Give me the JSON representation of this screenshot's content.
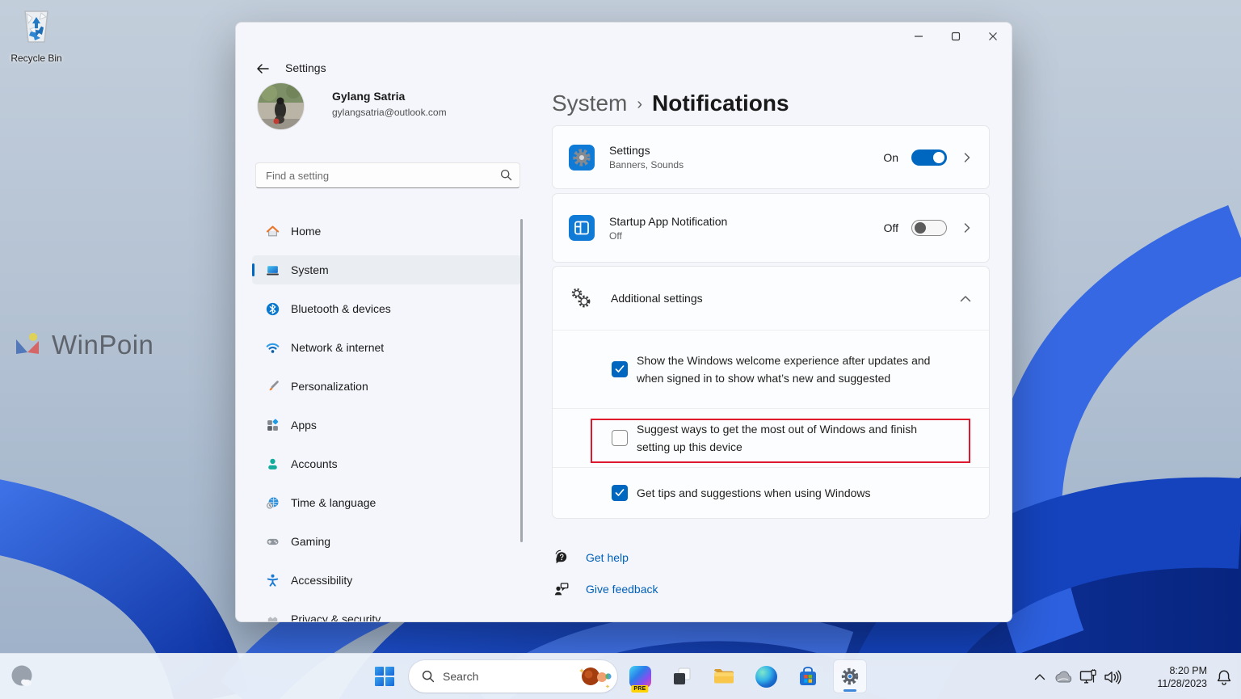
{
  "colors": {
    "accent": "#0067c0",
    "link": "#005fb8",
    "highlight_red": "#e0182d"
  },
  "desktop": {
    "recycle_bin_label": "Recycle Bin",
    "watermark": "WinPoin"
  },
  "window": {
    "titlebar": {
      "title": "Settings"
    },
    "profile": {
      "name": "Gylang Satria",
      "email": "gylangsatria@outlook.com"
    },
    "search": {
      "placeholder": "Find a setting"
    },
    "sidebar": {
      "items": [
        {
          "label": "Home"
        },
        {
          "label": "System"
        },
        {
          "label": "Bluetooth & devices"
        },
        {
          "label": "Network & internet"
        },
        {
          "label": "Personalization"
        },
        {
          "label": "Apps"
        },
        {
          "label": "Accounts"
        },
        {
          "label": "Time & language"
        },
        {
          "label": "Gaming"
        },
        {
          "label": "Accessibility"
        },
        {
          "label": "Privacy & security"
        }
      ]
    },
    "breadcrumb": {
      "parent": "System",
      "separator": "›",
      "current": "Notifications"
    },
    "cards": {
      "settings": {
        "title": "Settings",
        "subtitle": "Banners, Sounds",
        "state": "On"
      },
      "startup": {
        "title": "Startup App Notification",
        "subtitle": "Off",
        "state": "Off"
      },
      "additional": {
        "title": "Additional settings"
      }
    },
    "checkboxes": [
      {
        "label": "Show the Windows welcome experience after updates and when signed in to show what’s new and suggested",
        "checked": true,
        "highlighted": false
      },
      {
        "label": "Suggest ways to get the most out of Windows and finish setting up this device",
        "checked": false,
        "highlighted": true
      },
      {
        "label": "Get tips and suggestions when using Windows",
        "checked": true,
        "highlighted": false
      }
    ],
    "links": {
      "help": "Get help",
      "feedback": "Give feedback"
    }
  },
  "taskbar": {
    "search_label": "Search",
    "copilot_badge": "PRE",
    "tray": {
      "time": "8:20 PM",
      "date": "11/28/2023"
    }
  }
}
